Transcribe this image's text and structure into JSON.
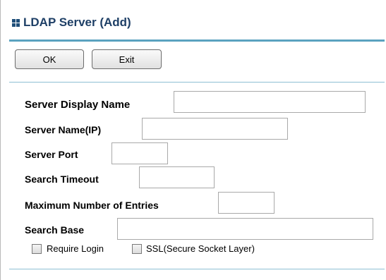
{
  "header": {
    "title": "LDAP Server (Add)",
    "icon": "grid-icon"
  },
  "toolbar": {
    "ok_label": "OK",
    "exit_label": "Exit"
  },
  "form": {
    "display_name": {
      "label": "Server Display Name",
      "value": ""
    },
    "server_name": {
      "label": "Server Name(IP)",
      "value": ""
    },
    "server_port": {
      "label": "Server Port",
      "value": ""
    },
    "search_timeout": {
      "label": "Search Timeout",
      "value": ""
    },
    "max_entries": {
      "label": "Maximum Number of Entries",
      "value": ""
    },
    "search_base": {
      "label": "Search Base",
      "value": ""
    },
    "require_login": {
      "label": "Require Login",
      "checked": false
    },
    "ssl": {
      "label": "SSL(Secure Socket Layer)",
      "checked": false
    }
  },
  "colors": {
    "title": "#1e3f66",
    "accent_rule": "#5aa2bf"
  }
}
